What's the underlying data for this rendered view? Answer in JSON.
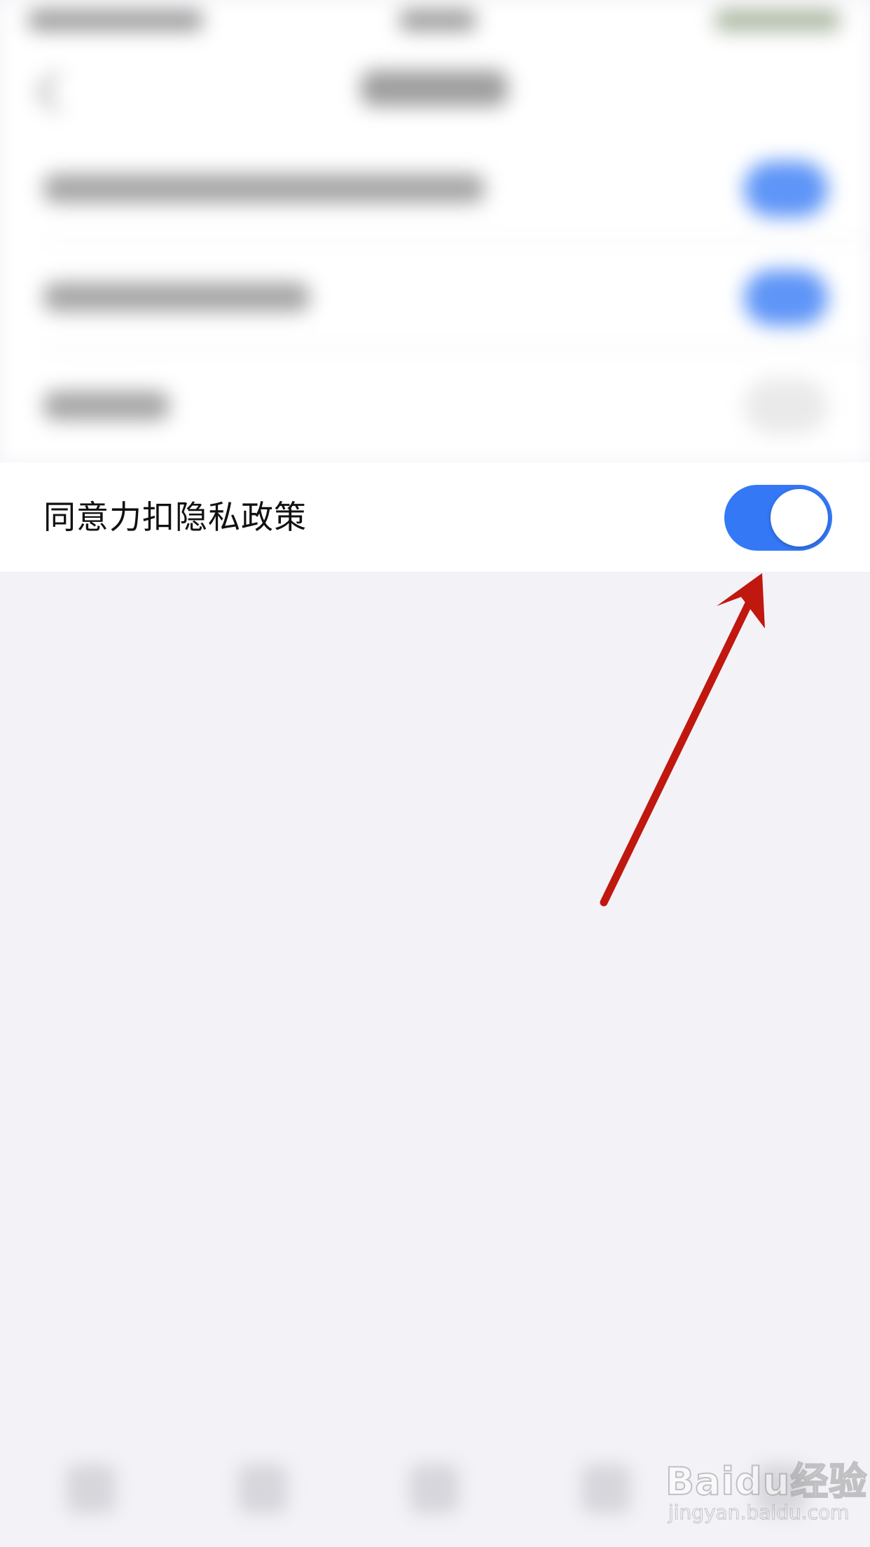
{
  "privacy_row": {
    "label": "同意力扣隐私政策",
    "toggle_on": true
  },
  "colors": {
    "toggle_on": "#3478f6",
    "background": "#f3f2f7",
    "row_background": "#ffffff",
    "arrow": "#c0170f"
  },
  "watermark": {
    "brand": "Baidu经验",
    "url": "jingyan.baidu.com"
  }
}
